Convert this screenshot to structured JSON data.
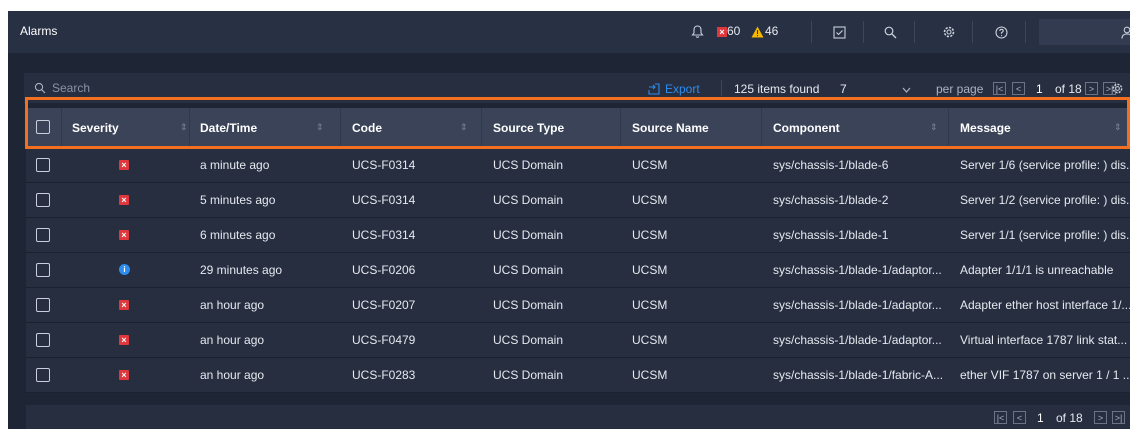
{
  "header": {
    "title": "Alarms",
    "critical_count": "60",
    "warning_count": "46"
  },
  "toolbar": {
    "search_placeholder": "Search",
    "export_label": "Export",
    "items_found": "125 items found",
    "per_page_value": "7",
    "per_page_label": "per page",
    "current_page": "1",
    "of_pages": "of 18"
  },
  "table": {
    "columns": [
      "Severity",
      "Date/Time",
      "Code",
      "Source Type",
      "Source Name",
      "Component",
      "Message"
    ],
    "rows": [
      {
        "severity": "critical",
        "datetime": "a minute ago",
        "code": "UCS-F0314",
        "source_type": "UCS Domain",
        "source_name": "UCSM",
        "component": "sys/chassis-1/blade-6",
        "message": "Server 1/6 (service profile: ) dis..."
      },
      {
        "severity": "critical",
        "datetime": "5 minutes ago",
        "code": "UCS-F0314",
        "source_type": "UCS Domain",
        "source_name": "UCSM",
        "component": "sys/chassis-1/blade-2",
        "message": "Server 1/2 (service profile: ) dis..."
      },
      {
        "severity": "critical",
        "datetime": "6 minutes ago",
        "code": "UCS-F0314",
        "source_type": "UCS Domain",
        "source_name": "UCSM",
        "component": "sys/chassis-1/blade-1",
        "message": "Server 1/1 (service profile: ) dis..."
      },
      {
        "severity": "info",
        "datetime": "29 minutes ago",
        "code": "UCS-F0206",
        "source_type": "UCS Domain",
        "source_name": "UCSM",
        "component": "sys/chassis-1/blade-1/adaptor...",
        "message": "Adapter 1/1/1 is unreachable"
      },
      {
        "severity": "critical",
        "datetime": "an hour ago",
        "code": "UCS-F0207",
        "source_type": "UCS Domain",
        "source_name": "UCSM",
        "component": "sys/chassis-1/blade-1/adaptor...",
        "message": "Adapter ether host interface 1/..."
      },
      {
        "severity": "critical",
        "datetime": "an hour ago",
        "code": "UCS-F0479",
        "source_type": "UCS Domain",
        "source_name": "UCSM",
        "component": "sys/chassis-1/blade-1/adaptor...",
        "message": "Virtual interface 1787 link stat..."
      },
      {
        "severity": "critical",
        "datetime": "an hour ago",
        "code": "UCS-F0283",
        "source_type": "UCS Domain",
        "source_name": "UCSM",
        "component": "sys/chassis-1/blade-1/fabric-A...",
        "message": "ether VIF 1787 on server 1 / 1 ..."
      }
    ]
  },
  "footer": {
    "current_page": "1",
    "of_pages": "of 18"
  },
  "colors": {
    "accent": "#2d8cf0",
    "critical": "#e0373d",
    "warning": "#f5b800",
    "highlight": "#f37021"
  }
}
